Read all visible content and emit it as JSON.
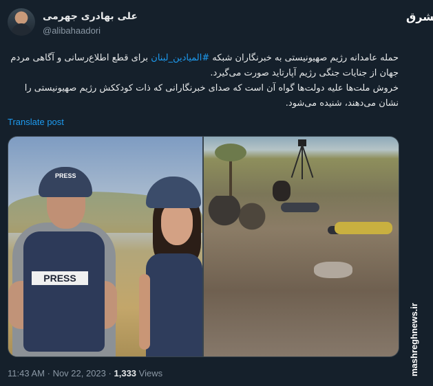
{
  "author": {
    "display_name": "علی بهادری جهرمی",
    "handle": "@alibahaadori"
  },
  "tweet": {
    "line1_a": "حمله عامدانه رژیم صهیونیستی به خبرنگاران شبکه ",
    "hashtag": "#المیادین_لبنان",
    "line1_b": " برای قطع اطلاع‌رسانی و آگاهی مردم جهان از جنایات جنگی رژیم آپارتاید صورت می‌گیرد.",
    "line2": "خروش ملت‌ها علیه دولت‌ها گواه آن است که صدای خبرنگارانی که ذات کودککش رژیم صهیونیستی را نشان می‌دهند، شنیده می‌شود.",
    "translate_label": "Translate post"
  },
  "media": {
    "left_helmet_label": "PRESS",
    "left_vest_label": "PRESS"
  },
  "meta": {
    "time": "11:43 AM",
    "separator": "·",
    "date": "Nov 22, 2023",
    "views_count": "1,333",
    "views_label": "Views"
  },
  "watermark": {
    "logo": "مشرق",
    "site": "mashreghnews.ir"
  }
}
